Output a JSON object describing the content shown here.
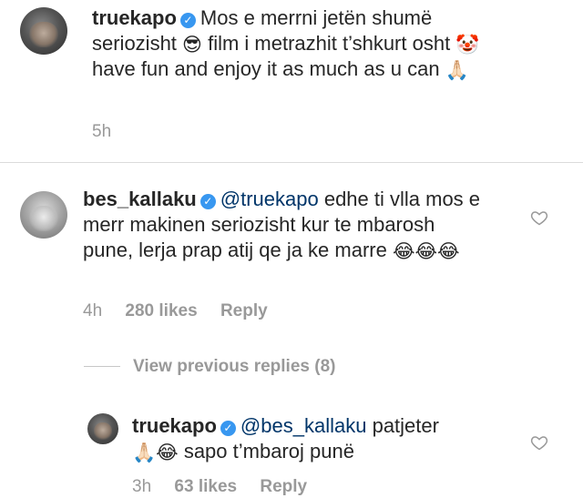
{
  "caption": {
    "username": "truekapo",
    "text_1": "Mos e merrni jetën shumë seriozisht",
    "emoji_1": "😎",
    "text_2": "film i metrazhit t’shkurt osht",
    "emoji_2": "🤡",
    "text_3": "have fun and enjoy it as much as u can",
    "emoji_3": "🙏🏻",
    "time": "5h"
  },
  "comments": [
    {
      "username": "bes_kallaku",
      "mention": "@truekapo",
      "text": "edhe ti vlla mos e merr makinen seriozisht kur te mbarosh pune, lerja prap atij qe ja ke marre",
      "emoji": "😂😂😂",
      "time": "4h",
      "likes": "280 likes",
      "reply": "Reply"
    }
  ],
  "view_previous": "View previous replies (8)",
  "reply_comment": {
    "username": "truekapo",
    "mention": "@bes_kallaku",
    "text_1": "patjeter",
    "emoji": "🙏🏻😂",
    "text_2": "sapo t’mbaroj punë",
    "time": "3h",
    "likes": "63 likes",
    "reply": "Reply"
  },
  "icons": {
    "verified": "verified-badge-icon",
    "like": "heart-outline-icon"
  },
  "colors": {
    "mention": "#003569",
    "meta": "#999999",
    "verified": "#3897f0"
  }
}
